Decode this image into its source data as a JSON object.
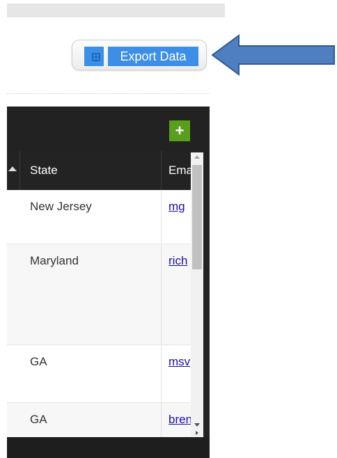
{
  "toolbar": {
    "export_label": "Export Data",
    "export_icon": "spreadsheet-icon"
  },
  "annotation": {
    "arrow_color": "#4f7ec1",
    "arrow_icon": "left-arrow-icon"
  },
  "grid": {
    "add_label": "+",
    "columns": {
      "state": "State",
      "email": "Ema"
    },
    "rows": [
      {
        "state": "New Jersey",
        "email": "mg"
      },
      {
        "state": "Maryland",
        "email": "rich"
      },
      {
        "state": "GA",
        "email": "msv"
      },
      {
        "state": "GA",
        "email": "bren"
      }
    ]
  },
  "colors": {
    "grid_header_bg": "#232323",
    "add_button_bg": "#5a9e1e",
    "export_highlight": "#3d8ee6",
    "link": "#1a0dab"
  }
}
